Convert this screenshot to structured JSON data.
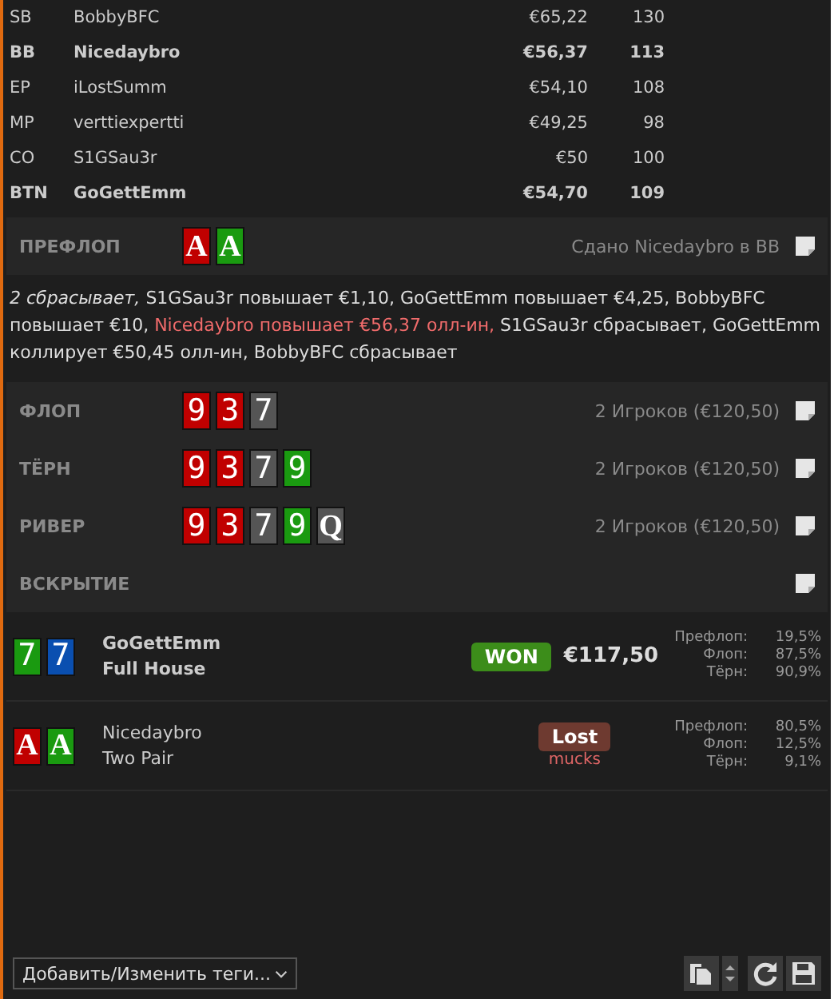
{
  "players": [
    {
      "position": "SB",
      "name": "BobbyBFC",
      "stack": "€65,22",
      "bb": "130",
      "highlighted": false
    },
    {
      "position": "BB",
      "name": "Nicedaybro",
      "stack": "€56,37",
      "bb": "113",
      "highlighted": true
    },
    {
      "position": "EP",
      "name": "iLostSumm",
      "stack": "€54,10",
      "bb": "108",
      "highlighted": false
    },
    {
      "position": "MP",
      "name": "verttiexpertti",
      "stack": "€49,25",
      "bb": "98",
      "highlighted": false
    },
    {
      "position": "CO",
      "name": "S1GSau3r",
      "stack": "€50",
      "bb": "100",
      "highlighted": false
    },
    {
      "position": "BTN",
      "name": "GoGettEmm",
      "stack": "€54,70",
      "bb": "109",
      "highlighted": true
    }
  ],
  "preflop": {
    "label": "ПРЕФЛОП",
    "cards": [
      {
        "rank": "A",
        "color": "#c00000"
      },
      {
        "rank": "A",
        "color": "#1a9a10"
      }
    ],
    "info": "Сдано Nicedaybro в BB"
  },
  "action_log": [
    {
      "kind": "italic",
      "text": "2 сбрасывает,"
    },
    {
      "kind": "normal",
      "text": "S1GSau3r повышает €1,10, GoGettEmm повышает €4,25, BobbyBFC повышает €10,"
    },
    {
      "kind": "allin",
      "text": "Nicedaybro повышает €56,37 олл-ин,"
    },
    {
      "kind": "normal",
      "text": "S1GSau3r сбрасывает, GoGettEmm коллирует €50,45 олл-ин, BobbyBFC сбрасывает"
    }
  ],
  "streets": [
    {
      "label": "ФЛОП",
      "info": "2 Игроков (€120,50)",
      "cards": [
        {
          "rank": "9",
          "color": "#c00000"
        },
        {
          "rank": "3",
          "color": "#c00000"
        },
        {
          "rank": "7",
          "color": "#555555"
        }
      ]
    },
    {
      "label": "ТЁРН",
      "info": "2 Игроков (€120,50)",
      "cards": [
        {
          "rank": "9",
          "color": "#c00000"
        },
        {
          "rank": "3",
          "color": "#c00000"
        },
        {
          "rank": "7",
          "color": "#555555"
        },
        {
          "rank": "9",
          "color": "#1a9a10"
        }
      ]
    },
    {
      "label": "РИВЕР",
      "info": "2 Игроков (€120,50)",
      "cards": [
        {
          "rank": "9",
          "color": "#c00000"
        },
        {
          "rank": "3",
          "color": "#c00000"
        },
        {
          "rank": "7",
          "color": "#555555"
        },
        {
          "rank": "9",
          "color": "#1a9a10"
        },
        {
          "rank": "Q",
          "color": "#555555"
        }
      ]
    },
    {
      "label": "ВСКРЫТИЕ"
    }
  ],
  "results": [
    {
      "kind": "won",
      "name": "GoGettEmm",
      "hand": "Full House",
      "badge": "WON",
      "amount": "€117,50",
      "cards": [
        {
          "rank": "7",
          "color": "#1a9a10"
        },
        {
          "rank": "7",
          "color": "#0a4fb0"
        }
      ],
      "equity": [
        {
          "label": "Префлоп:",
          "value": "19,5%"
        },
        {
          "label": "Флоп:",
          "value": "87,5%"
        },
        {
          "label": "Тёрн:",
          "value": "90,9%"
        }
      ]
    },
    {
      "kind": "lost",
      "name": "Nicedaybro",
      "hand": "Two Pair",
      "badge": "Lost",
      "note": "mucks",
      "cards": [
        {
          "rank": "A",
          "color": "#c00000"
        },
        {
          "rank": "A",
          "color": "#1a9a10"
        }
      ],
      "equity": [
        {
          "label": "Префлоп:",
          "value": "80,5%"
        },
        {
          "label": "Флоп:",
          "value": "12,5%"
        },
        {
          "label": "Тёрн:",
          "value": "9,1%"
        }
      ]
    }
  ],
  "tags_dropdown": {
    "placeholder": "Добавить/Изменить теги..."
  }
}
